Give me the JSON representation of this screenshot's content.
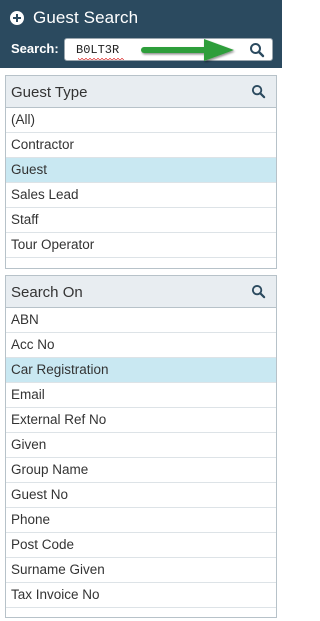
{
  "header": {
    "title": "Guest Search",
    "add_icon": "plus-circle-icon",
    "search_label": "Search:",
    "search_value": "B0LT3R",
    "search_icon": "search-icon",
    "annotation_arrow": "green-arrow",
    "bg_color": "#2b4a5f",
    "arrow_color": "#2e9e3a"
  },
  "guest_type_panel": {
    "title": "Guest Type",
    "search_icon": "search-icon",
    "items": [
      {
        "label": "(All)",
        "selected": false
      },
      {
        "label": "Contractor",
        "selected": false
      },
      {
        "label": "Guest",
        "selected": true
      },
      {
        "label": "Sales Lead",
        "selected": false
      },
      {
        "label": "Staff",
        "selected": false
      },
      {
        "label": "Tour Operator",
        "selected": false
      }
    ]
  },
  "search_on_panel": {
    "title": "Search On",
    "search_icon": "search-icon",
    "items": [
      {
        "label": "ABN",
        "selected": false
      },
      {
        "label": "Acc No",
        "selected": false
      },
      {
        "label": "Car Registration",
        "selected": true
      },
      {
        "label": "Email",
        "selected": false
      },
      {
        "label": "External Ref No",
        "selected": false
      },
      {
        "label": "Given",
        "selected": false
      },
      {
        "label": "Group Name",
        "selected": false
      },
      {
        "label": "Guest No",
        "selected": false
      },
      {
        "label": "Phone",
        "selected": false
      },
      {
        "label": "Post Code",
        "selected": false
      },
      {
        "label": "Surname Given",
        "selected": false
      },
      {
        "label": "Tax Invoice No",
        "selected": false
      }
    ]
  },
  "colors": {
    "selected_row": "#c9e8f2",
    "panel_header": "#e8edf1"
  }
}
